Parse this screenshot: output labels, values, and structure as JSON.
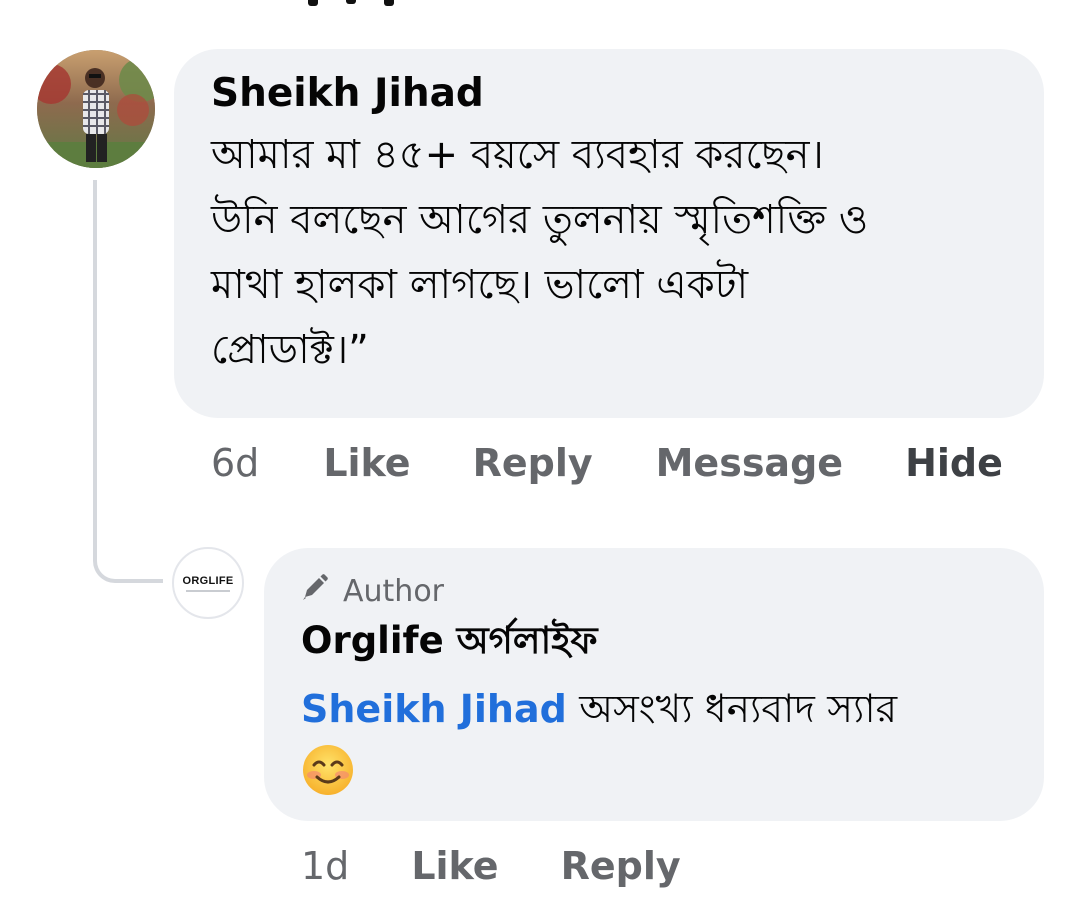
{
  "comment": {
    "author": "Sheikh Jihad",
    "lines": [
      "আমার মা ৪৫+ বয়সে ব্যবহার করছেন।",
      "উনি বলছেন আগের তুলনায় স্মৃতিশক্তি ও",
      "মাথা হালকা লাগছে। ভালো একটা",
      "প্রোডাক্ট।”"
    ],
    "actions": {
      "time": "6d",
      "like": "Like",
      "reply": "Reply",
      "message": "Message",
      "hide": "Hide"
    },
    "avatar_icon": "profile-photo"
  },
  "reply": {
    "badge": "Author",
    "badge_icon": "pen-icon",
    "author": "Orglife অর্গলাইফ",
    "avatar_logo_text": "ORGLIFE",
    "mention": "Sheikh Jihad",
    "text": "অসংখ্য ধন্যবাদ স্যার",
    "emoji": "smiling-face-with-smiling-eyes",
    "actions": {
      "time": "1d",
      "like": "Like",
      "reply": "Reply"
    }
  },
  "colors": {
    "bubble_bg": "#f0f2f5",
    "action_text": "#65676b",
    "mention": "#216fdb",
    "thread_line": "#d5d8dd"
  }
}
